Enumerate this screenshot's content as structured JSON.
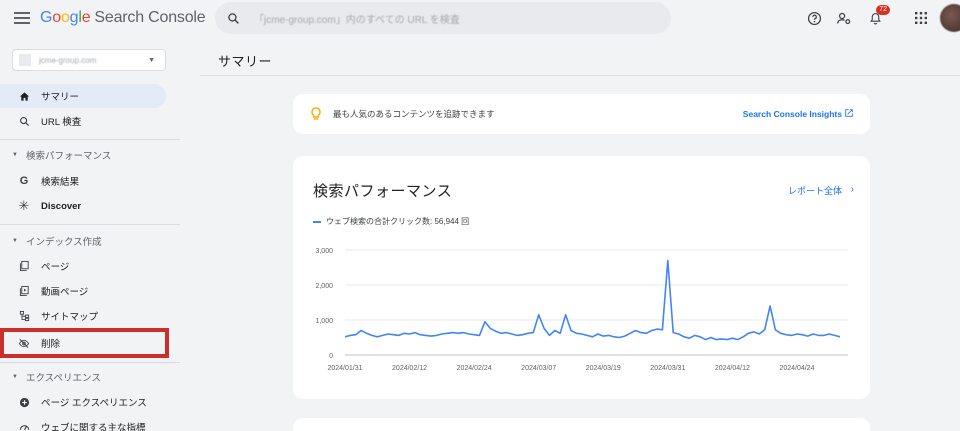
{
  "header": {
    "logo": {
      "g": "G",
      "o1": "o",
      "o2": "o",
      "g2": "g",
      "l": "l",
      "e": "e",
      "rest": "Search Console"
    },
    "search_placeholder": "「jcme-group.com」内のすべての URL を検査",
    "notification_count": "72",
    "icons": [
      "help-icon",
      "manage-accounts-icon",
      "notifications-icon",
      "apps-icon"
    ]
  },
  "sidebar": {
    "property": "jcme-group.com",
    "items": [
      {
        "label": "サマリー",
        "icon": "home-icon",
        "active": true
      },
      {
        "label": "URL 検査",
        "icon": "search-icon"
      }
    ],
    "sections": [
      {
        "title": "検索パフォーマンス",
        "items": [
          {
            "label": "検索結果",
            "icon": "google-g-icon"
          },
          {
            "label": "Discover",
            "icon": "asterisk-icon"
          }
        ]
      },
      {
        "title": "インデックス作成",
        "items": [
          {
            "label": "ページ",
            "icon": "pages-icon"
          },
          {
            "label": "動画ページ",
            "icon": "video-pages-icon"
          },
          {
            "label": "サイトマップ",
            "icon": "sitemap-icon"
          },
          {
            "label": "削除",
            "icon": "eye-off-icon"
          }
        ]
      },
      {
        "title": "エクスペリエンス",
        "items": [
          {
            "label": "ページ エクスペリエンス",
            "icon": "add-circle-icon"
          },
          {
            "label": "ウェブに関する主な指標",
            "icon": "speed-icon"
          }
        ]
      }
    ]
  },
  "main": {
    "title": "サマリー",
    "insights": {
      "message": "最も人気のあるコンテンツを追跡できます",
      "link": "Search Console Insights"
    },
    "performance": {
      "title": "検索パフォーマンス",
      "report_link": "レポート全体",
      "legend": "ウェブ検索の合計クリック数: 56,944 回"
    }
  },
  "colors": {
    "accent": "#1a73e8",
    "line": "#4285f4",
    "highlight_box": "#c9302c",
    "active_nav": "#e3eaf8"
  },
  "chart_data": {
    "type": "line",
    "xlabel": "",
    "ylabel": "",
    "ylim": [
      0,
      3000
    ],
    "y_ticks": [
      "3,000",
      "2,000",
      "1,000",
      "0"
    ],
    "x_ticks": [
      "2024/01/31",
      "2024/02/12",
      "2024/02/24",
      "2024/03/07",
      "2024/03/19",
      "2024/03/31",
      "2024/04/12",
      "2024/04/24"
    ],
    "grid": true,
    "series": [
      {
        "name": "ウェブ検索の合計クリック数",
        "x_start": "2024/01/31",
        "values": [
          520,
          560,
          580,
          700,
          620,
          560,
          520,
          560,
          600,
          580,
          560,
          620,
          600,
          640,
          580,
          560,
          540,
          560,
          600,
          620,
          640,
          620,
          640,
          600,
          580,
          560,
          950,
          760,
          680,
          620,
          640,
          600,
          560,
          580,
          620,
          640,
          1150,
          760,
          560,
          700,
          620,
          1150,
          700,
          620,
          600,
          560,
          520,
          600,
          540,
          560,
          520,
          500,
          540,
          620,
          700,
          640,
          620,
          700,
          740,
          720,
          2700,
          640,
          600,
          520,
          480,
          560,
          520,
          440,
          500,
          440,
          460,
          440,
          480,
          440,
          520,
          620,
          660,
          600,
          720,
          1400,
          720,
          620,
          580,
          560,
          600,
          580,
          540,
          600,
          560,
          560,
          600,
          560,
          520
        ]
      }
    ]
  }
}
